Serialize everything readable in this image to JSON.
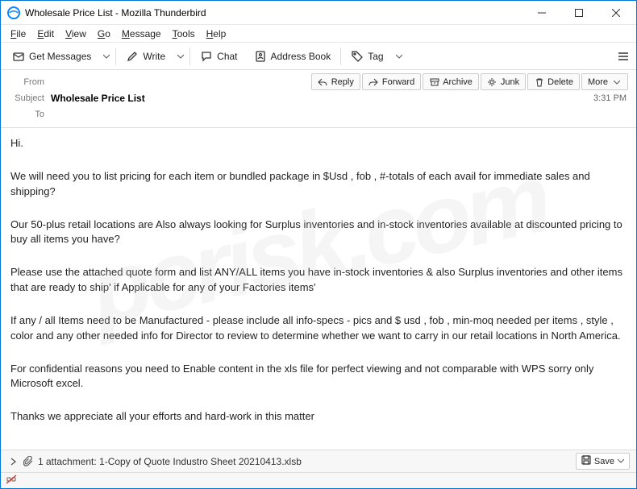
{
  "window": {
    "title": "Wholesale Price List - Mozilla Thunderbird"
  },
  "menu": {
    "mfile": "File",
    "medit": "Edit",
    "mview": "View",
    "mgo": "Go",
    "mmessage": "Message",
    "mtools": "Tools",
    "mhelp": "Help"
  },
  "toolbar": {
    "get_messages": "Get Messages",
    "write": "Write",
    "chat": "Chat",
    "address_book": "Address Book",
    "tag": "Tag"
  },
  "headers": {
    "from_label": "From",
    "from_value": "",
    "subject_label": "Subject",
    "subject_value": "Wholesale Price List",
    "to_label": "To",
    "to_value": "",
    "time": "3:31 PM"
  },
  "actions": {
    "reply": "Reply",
    "forward": "Forward",
    "archive": "Archive",
    "junk": "Junk",
    "delete": "Delete",
    "more": "More"
  },
  "body": {
    "p1": "Hi.",
    "p2": "We will need you to list pricing for each item or bundled package in $Usd , fob , #-totals of each avail for immediate sales and shipping?",
    "p3": "Our 50-plus retail locations are Also always looking for Surplus inventories and in-stock inventories available at discounted pricing to buy all items you have?",
    "p4": "Please use the attached quote form and list ANY/ALL items you have in-stock inventories & also Surplus inventories and  other items that are ready to ship' if Applicable for any of your Factories items'",
    "p5": "If any / all Items need to be Manufactured - please include all info-specs - pics and $ usd ,  fob , min-moq needed per items , style , color and any other needed info for Director to review to determine whether we want to carry in our retail locations in North America.",
    "p6": "For confidential reasons you need to Enable content in the xls file for perfect viewing and not comparable with WPS sorry only Microsoft excel.",
    "p7": "Thanks  we appreciate all your efforts and hard-work in this matter"
  },
  "attachment": {
    "summary": "1 attachment: 1-Copy of Quote Industro Sheet 20210413.xlsb",
    "save": "Save"
  },
  "watermark": "pcrisk.com"
}
